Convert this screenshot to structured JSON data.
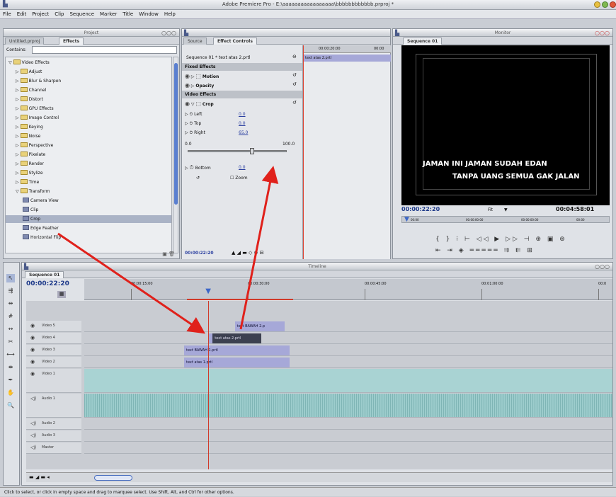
{
  "app": {
    "title": "Adobe Premiere Pro - E:\\aaaaaaaaaaaaaaaaa\\bbbbbbbbbbbb.prproj *"
  },
  "menu": [
    "File",
    "Edit",
    "Project",
    "Clip",
    "Sequence",
    "Marker",
    "Title",
    "Window",
    "Help"
  ],
  "project_panel": {
    "title": "Project",
    "tabs": [
      "Untitled.prproj",
      "Effects"
    ],
    "contains_label": "Contains:",
    "tree": [
      {
        "label": "Video Effects",
        "depth": 0,
        "type": "folder",
        "open": true
      },
      {
        "label": "Adjust",
        "depth": 1,
        "type": "folder"
      },
      {
        "label": "Blur & Sharpen",
        "depth": 1,
        "type": "folder"
      },
      {
        "label": "Channel",
        "depth": 1,
        "type": "folder"
      },
      {
        "label": "Distort",
        "depth": 1,
        "type": "folder"
      },
      {
        "label": "GPU Effects",
        "depth": 1,
        "type": "folder"
      },
      {
        "label": "Image Control",
        "depth": 1,
        "type": "folder"
      },
      {
        "label": "Keying",
        "depth": 1,
        "type": "folder"
      },
      {
        "label": "Noise",
        "depth": 1,
        "type": "folder"
      },
      {
        "label": "Perspective",
        "depth": 1,
        "type": "folder"
      },
      {
        "label": "Pixelate",
        "depth": 1,
        "type": "folder"
      },
      {
        "label": "Render",
        "depth": 1,
        "type": "folder"
      },
      {
        "label": "Stylize",
        "depth": 1,
        "type": "folder"
      },
      {
        "label": "Time",
        "depth": 1,
        "type": "folder"
      },
      {
        "label": "Transform",
        "depth": 1,
        "type": "folder",
        "open": true
      },
      {
        "label": "Camera View",
        "depth": 2,
        "type": "effect"
      },
      {
        "label": "Clip",
        "depth": 2,
        "type": "effect"
      },
      {
        "label": "Crop",
        "depth": 2,
        "type": "effect",
        "selected": true
      },
      {
        "label": "Edge Feather",
        "depth": 2,
        "type": "effect"
      },
      {
        "label": "Horizontal Flip",
        "depth": 2,
        "type": "effect"
      }
    ]
  },
  "effect_controls": {
    "tabs": [
      "Source",
      "Effect Controls"
    ],
    "source_line": "Sequence 01 * text atas 2.prtl",
    "timecode_start": "00:00:20:00",
    "timecode_end": "00:00",
    "clip_label": "text atas 2.prtl",
    "fixed_effects": "Fixed Effects",
    "motion": "Motion",
    "opacity": "Opacity",
    "video_effects": "Video Effects",
    "crop": "Crop",
    "params": [
      {
        "name": "Left",
        "value": "0.0"
      },
      {
        "name": "Top",
        "value": "0.0"
      },
      {
        "name": "Right",
        "value": "65.0"
      }
    ],
    "slider_min": "0.0",
    "slider_max": "100.0",
    "slider_value": 0.65,
    "bottom": {
      "name": "Bottom",
      "value": "0.0"
    },
    "zoom_label": "Zoom",
    "timecode": "00:00:22:20"
  },
  "monitor": {
    "title": "Monitor",
    "tab": "Sequence 01",
    "caption_line1": "JAMAN INI JAMAN SUDAH EDAN",
    "caption_line2": "TANPA UANG SEMUA GAK JALAN",
    "timecode_current": "00:00:22:20",
    "fit": "Fit",
    "timecode_duration": "00:04:58:01",
    "ruler": [
      "00:00",
      "00:00:00:00",
      "00:00:00:00",
      "00:00"
    ]
  },
  "timeline": {
    "title": "Timeline",
    "tab": "Sequence 01",
    "timecode": "00:00:22:20",
    "ruler": [
      "00:00:15:00",
      "00:00:30:00",
      "00:00:45:00",
      "00:01:00:00",
      "00:0"
    ],
    "playhead_fraction": 0.235,
    "tracks": [
      {
        "name": "Video 5",
        "clips": [
          {
            "label": "text BAWAH 2.p",
            "start": 0.285,
            "end": 0.38
          }
        ]
      },
      {
        "name": "Video 4",
        "clips": [
          {
            "label": "text atas 2.prtl",
            "start": 0.235,
            "end": 0.335,
            "selected": true
          }
        ]
      },
      {
        "name": "Video 3",
        "clips": [
          {
            "label": "text BAWAH 1.prtl",
            "start": 0.189,
            "end": 0.389
          }
        ]
      },
      {
        "name": "Video 2",
        "clips": [
          {
            "label": "text atas 1.prtl",
            "start": 0.189,
            "end": 0.389
          }
        ]
      },
      {
        "name": "Video 1",
        "clips": []
      },
      {
        "name": "Audio 1",
        "clips": []
      },
      {
        "name": "Audio 2",
        "clips": []
      },
      {
        "name": "Audio 3",
        "clips": []
      },
      {
        "name": "Master",
        "clips": []
      }
    ]
  },
  "status_bar": "Click to select, or click in empty space and drag to marquee select. Use Shift, Alt, and Ctrl for other options.",
  "colors": {
    "clip": "#a6a8d8",
    "clip_selected": "#3c4050",
    "video1": "#a9d3d3",
    "audio": "#8fc1c1",
    "arrow": "#e0211b",
    "accent": "#1e3a8a"
  }
}
